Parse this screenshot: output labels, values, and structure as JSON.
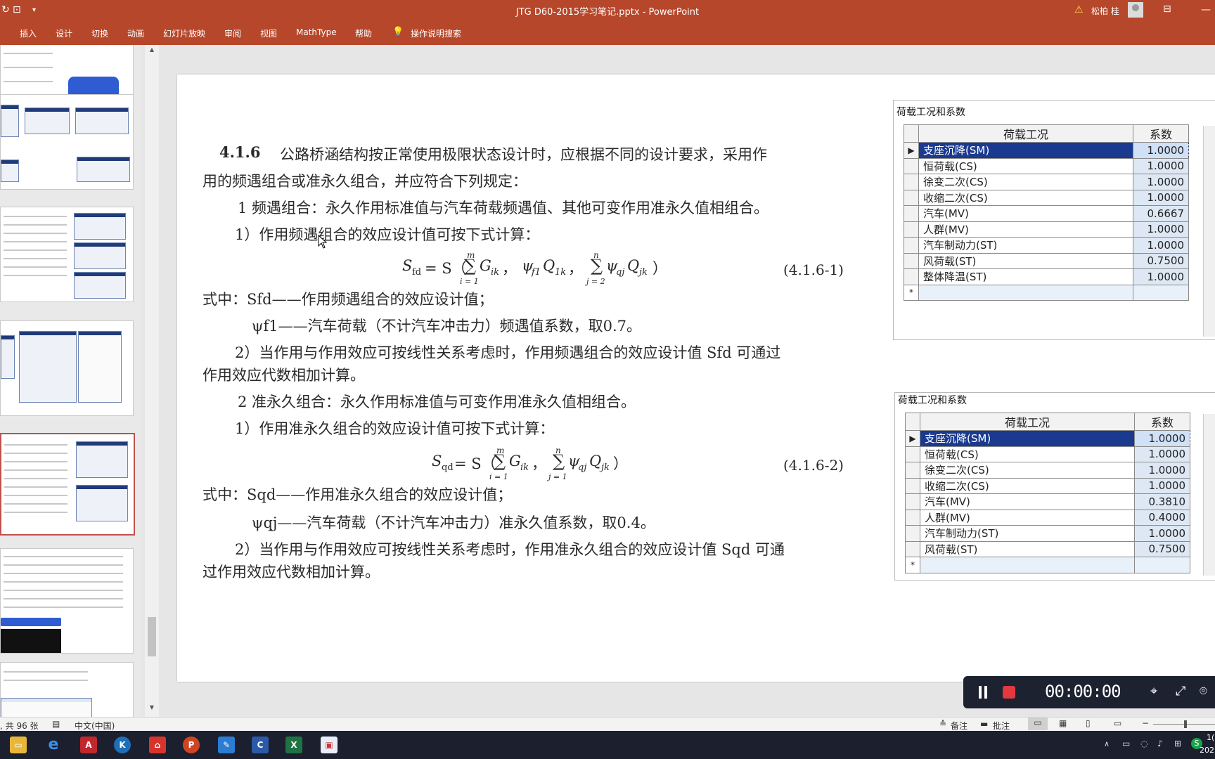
{
  "window": {
    "title": "JTG D60-2015学习笔记.pptx  -  PowerPoint",
    "user": "松柏 桂",
    "warning_icon": "warning-icon"
  },
  "ribbon": {
    "tabs": [
      "插入",
      "设计",
      "切换",
      "动画",
      "幻灯片放映",
      "审阅",
      "视图",
      "MathType",
      "帮助"
    ],
    "search": "操作说明搜索"
  },
  "slide": {
    "clause_num": "4.1.6",
    "p1a": "公路桥涵结构按正常使用极限状态设计时，应根据不同的设计要求，采用作",
    "p1b": "用的频遇组合或准永久组合，并应符合下列规定：",
    "p2": "1  频遇组合：永久作用标准值与汽车荷载频遇值、其他可变作用准永久值相组合。",
    "p3": "1）作用频遇组合的效应设计值可按下式计算：",
    "formula1": {
      "lhs": "S",
      "lhs_sub": "fd",
      "mid1": " = S（",
      "sum1_top": "m",
      "sum1_bot": "i = 1",
      "term1": "G",
      "term1_sub": "ik",
      "comma1": "，",
      "term2": "ψ",
      "term2_sub": "f1",
      "term3": "Q",
      "term3_sub": "1k",
      "comma2": "，",
      "sum2_top": "n",
      "sum2_bot": "j = 2",
      "term4": "ψ",
      "term4_sub": "qj",
      "term5": "Q",
      "term5_sub": "jk",
      "close": "）",
      "number": "(4.1.6-1)"
    },
    "p4": "式中：Sfd——作用频遇组合的效应设计值；",
    "p5": "ψf1——汽车荷载（不计汽车冲击力）频遇值系数，取0.7。",
    "p6a": "2）当作用与作用效应可按线性关系考虑时，作用频遇组合的效应设计值 Sfd 可通过",
    "p6b": "作用效应代数相加计算。",
    "p7": "2  准永久组合：永久作用标准值与可变作用准永久值相组合。",
    "p8": "1）作用准永久组合的效应设计值可按下式计算：",
    "formula2": {
      "lhs": "S",
      "lhs_sub": "qd",
      "mid1": " = S（",
      "sum1_top": "m",
      "sum1_bot": "i = 1",
      "term1": "G",
      "term1_sub": "ik",
      "comma1": "，",
      "sum2_top": "n",
      "sum2_bot": "j = 1",
      "term4": "ψ",
      "term4_sub": "qj",
      "term5": "Q",
      "term5_sub": "jk",
      "close": "）",
      "number": "(4.1.6-2)"
    },
    "p9": "式中：Sqd——作用准永久组合的效应设计值；",
    "p10": "ψqj——汽车荷载（不计汽车冲击力）准永久值系数，取0.4。",
    "p11a": "2）当作用与作用效应可按线性关系考虑时，作用准永久组合的效应设计值 Sqd 可通",
    "p11b": "过作用效应代数相加计算。"
  },
  "table1": {
    "title": "荷载工况和系数",
    "col_name": "荷载工况",
    "col_coef": "系数",
    "rows": [
      {
        "name": "支座沉降(SM)",
        "coef": "1.0000"
      },
      {
        "name": "恒荷载(CS)",
        "coef": "1.0000"
      },
      {
        "name": "徐变二次(CS)",
        "coef": "1.0000"
      },
      {
        "name": "收缩二次(CS)",
        "coef": "1.0000"
      },
      {
        "name": "汽车(MV)",
        "coef": "0.6667"
      },
      {
        "name": "人群(MV)",
        "coef": "1.0000"
      },
      {
        "name": "汽车制动力(ST)",
        "coef": "1.0000"
      },
      {
        "name": "风荷载(ST)",
        "coef": "0.7500"
      },
      {
        "name": "整体降温(ST)",
        "coef": "1.0000"
      }
    ],
    "selected_marker": "▶",
    "new_row_marker": "*"
  },
  "table2": {
    "title": "荷载工况和系数",
    "col_name": "荷载工况",
    "col_coef": "系数",
    "rows": [
      {
        "name": "支座沉降(SM)",
        "coef": "1.0000"
      },
      {
        "name": "恒荷载(CS)",
        "coef": "1.0000"
      },
      {
        "name": "徐变二次(CS)",
        "coef": "1.0000"
      },
      {
        "name": "收缩二次(CS)",
        "coef": "1.0000"
      },
      {
        "name": "汽车(MV)",
        "coef": "0.3810"
      },
      {
        "name": "人群(MV)",
        "coef": "0.4000"
      },
      {
        "name": "汽车制动力(ST)",
        "coef": "1.0000"
      },
      {
        "name": "风荷载(ST)",
        "coef": "0.7500"
      }
    ],
    "selected_marker": "▶",
    "new_row_marker": "*"
  },
  "recorder": {
    "time": "00:00:00"
  },
  "statusbar": {
    "slide_count": ", 共 96 张",
    "language": "中文(中国)",
    "notes": "备注",
    "comments": "批注"
  },
  "taskbar": {
    "clock_top": "1(",
    "clock_bottom": "202"
  }
}
